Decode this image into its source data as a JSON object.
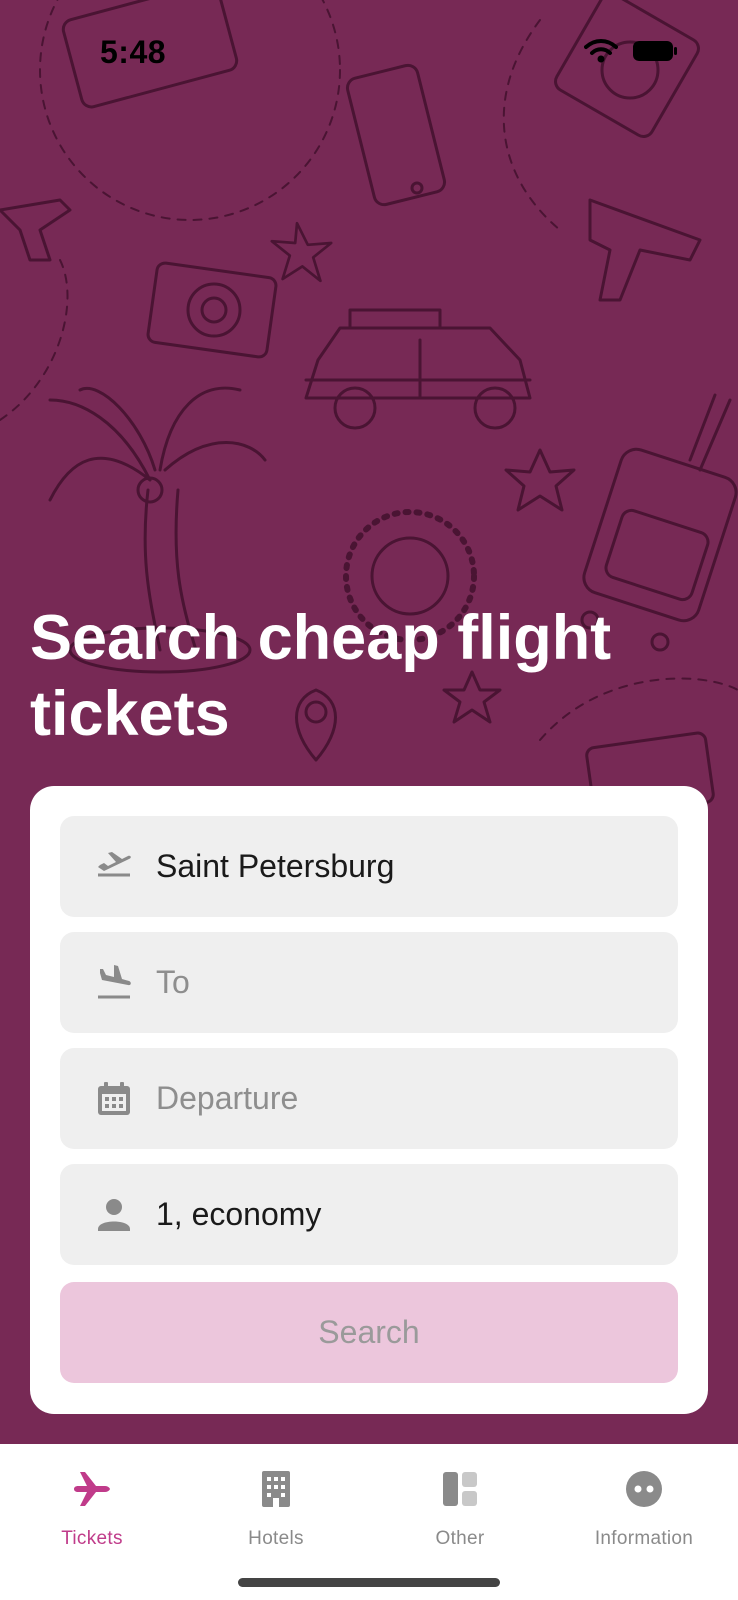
{
  "status_bar": {
    "time": "5:48"
  },
  "hero": {
    "headline": "Search cheap flight tickets"
  },
  "form": {
    "from": {
      "value": "Saint Petersburg",
      "icon": "plane-takeoff-icon"
    },
    "to": {
      "placeholder": "To",
      "icon": "plane-landing-icon"
    },
    "departure": {
      "placeholder": "Departure",
      "icon": "calendar-icon"
    },
    "passengers": {
      "value": "1, economy",
      "icon": "person-icon"
    },
    "search_label": "Search"
  },
  "tabs": [
    {
      "label": "Tickets",
      "icon": "plane-icon",
      "active": true
    },
    {
      "label": "Hotels",
      "icon": "building-icon",
      "active": false
    },
    {
      "label": "Other",
      "icon": "grid-icon",
      "active": false
    },
    {
      "label": "Information",
      "icon": "info-dots-icon",
      "active": false
    }
  ],
  "colors": {
    "background": "#772955",
    "accent": "#c03b8a",
    "search_disabled": "#ecc6dc",
    "field_bg": "#efefef"
  }
}
